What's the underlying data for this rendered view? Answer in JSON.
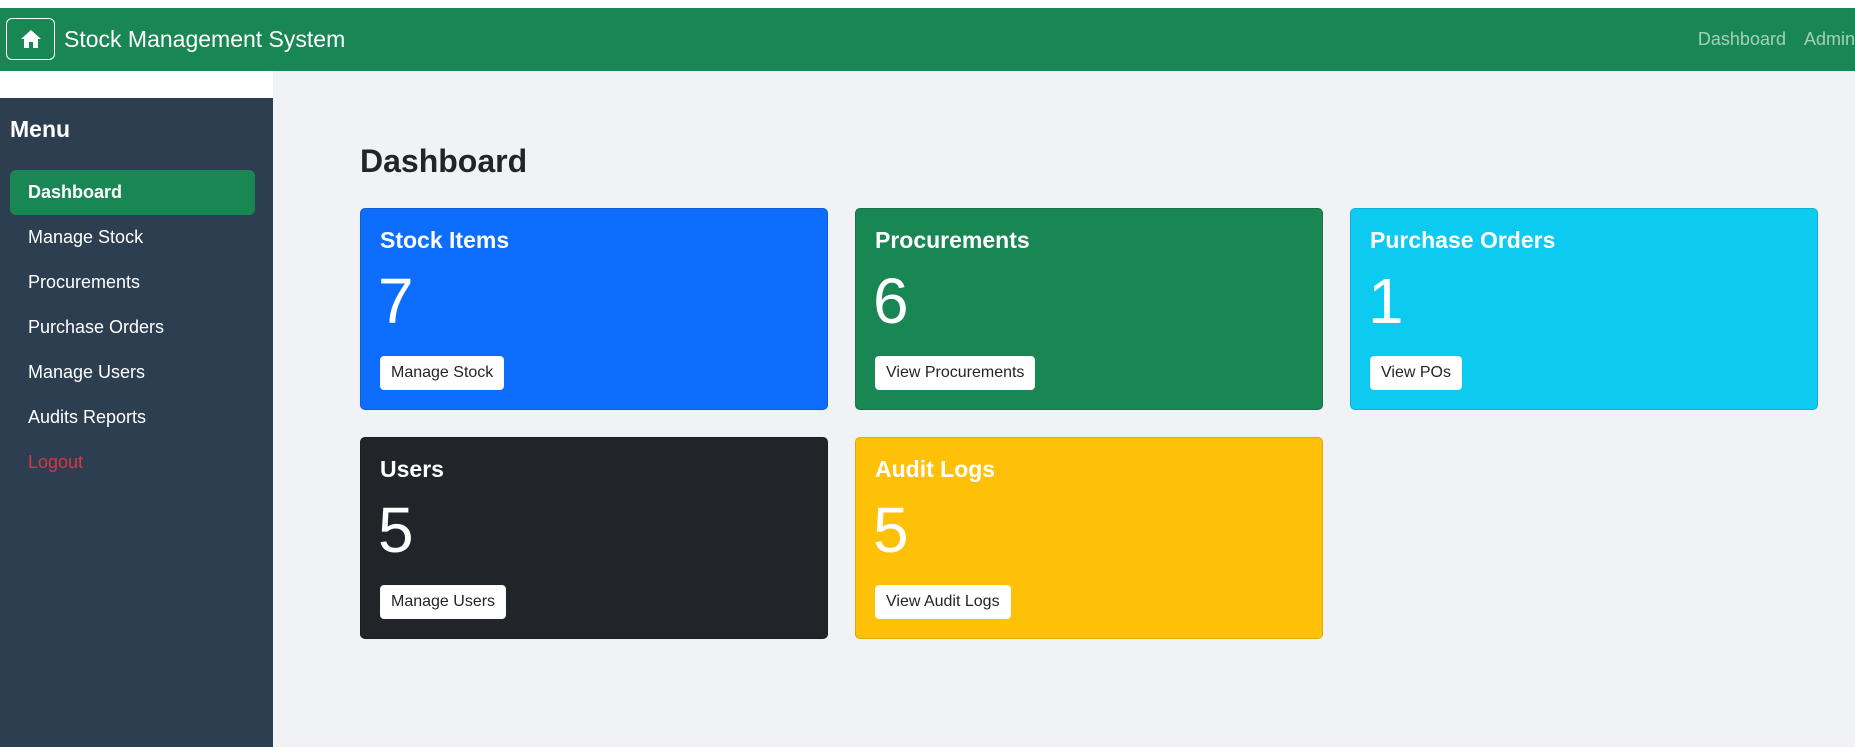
{
  "navbar": {
    "brand": "Stock Management System",
    "links": [
      "Dashboard",
      "Admin"
    ],
    "color": "#198754"
  },
  "sidebar": {
    "title": "Menu",
    "items": [
      {
        "label": "Dashboard",
        "active": true
      },
      {
        "label": "Manage Stock"
      },
      {
        "label": "Procurements"
      },
      {
        "label": "Purchase Orders"
      },
      {
        "label": "Manage Users"
      },
      {
        "label": "Audits Reports"
      },
      {
        "label": "Logout"
      }
    ],
    "color": "#2c3e50"
  },
  "main": {
    "title": "Dashboard",
    "cards": [
      {
        "title": "Stock Items",
        "count": "7",
        "button": "Manage Stock",
        "color": "#0d6efd"
      },
      {
        "title": "Procurements",
        "count": "6",
        "button": "View Procurements",
        "color": "#198754"
      },
      {
        "title": "Purchase Orders",
        "count": "1",
        "button": "View POs",
        "color": "#0dcaf0"
      },
      {
        "title": "Users",
        "count": "5",
        "button": "Manage Users",
        "color": "#212529"
      },
      {
        "title": "Audit Logs",
        "count": "5",
        "button": "View Audit Logs",
        "color": "#ffc107"
      }
    ]
  },
  "icons": {
    "home": "home-icon"
  }
}
